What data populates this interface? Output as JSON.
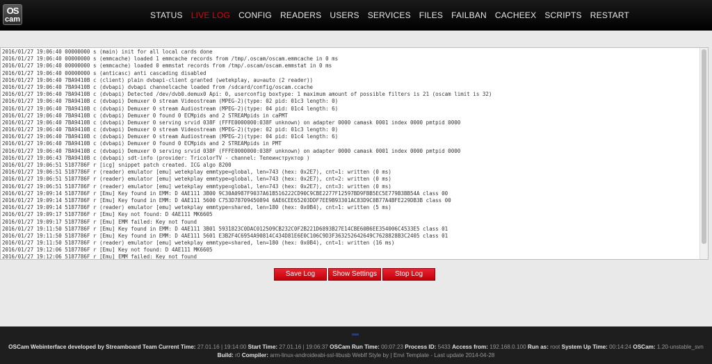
{
  "logo": {
    "line1": "OS",
    "line2": "cam"
  },
  "nav": [
    "STATUS",
    "LIVE LOG",
    "CONFIG",
    "READERS",
    "USERS",
    "SERVICES",
    "FILES",
    "FAILBAN",
    "CACHEEX",
    "SCRIPTS",
    "RESTART"
  ],
  "nav_active": "LIVE LOG",
  "log": [
    "2016/01/27 19:06:40 00000000 s (main) init for all local cards done",
    "2016/01/27 19:06:40 00000000 s (emmcache) loaded 1 emmcache records from /tmp/.oscam/oscam.emmcache in 0 ms",
    "2016/01/27 19:06:40 00000000 s (emmcache) loaded 0 emmstat records from /tmp/.oscam/oscam.emmstat in 0 ms",
    "2016/01/27 19:06:40 00000000 s (anticasc) anti cascading disabled",
    "2016/01/27 19:06:40 7BA9410B c (client) plain dvbapi-client granted (wetekplay, au=auto (2 reader))",
    "2016/01/27 19:06:40 7BA9410B c (dvbapi) dvbapi channelcache loaded from /sdcard/config/oscam.ccache",
    "2016/01/27 19:06:40 7BA9410B c (dvbapi) Detected /dev/dvb0.demux0 Api: 0, userconfig boxtype: 1 maximum amount of possible filters is 21 (oscam limit is 32)",
    "2016/01/27 19:06:40 7BA9410B c (dvbapi) Demuxer 0 stream Videostream (MPEG-2)(type: 02 pid: 01c3 length: 0)",
    "2016/01/27 19:06:40 7BA9410B c (dvbapi) Demuxer 0 stream Audiostream (MPEG-2)(type: 04 pid: 01c4 length: 6)",
    "2016/01/27 19:06:40 7BA9410B c (dvbapi) Demuxer 0 found 0 ECMpids and 2 STREAMpids in caPMT",
    "2016/01/27 19:06:40 7BA9410B c (dvbapi) Demuxer 0 serving srvid 038F (FFFE0000000:038F unknown) on adapter 0000 camask 0001 index 0000 pmtpid 0000",
    "2016/01/27 19:06:40 7BA9410B c (dvbapi) Demuxer 0 stream Videostream (MPEG-2)(type: 02 pid: 01c3 length: 0)",
    "2016/01/27 19:06:40 7BA9410B c (dvbapi) Demuxer 0 stream Audiostream (MPEG-2)(type: 04 pid: 01c4 length: 6)",
    "2016/01/27 19:06:40 7BA9410B c (dvbapi) Demuxer 0 found 0 ECMpids and 2 STREAMpids in PMT",
    "2016/01/27 19:06:40 7BA9410B c (dvbapi) Demuxer 0 serving srvid 038F (FFFE0000000:038F unknown) on adapter 0000 camask 0001 index 0000 pmtpid 0000",
    "2016/01/27 19:06:43 7BA9410B c (dvbapi) sdt-info (provider: TricolorTV - channel: Телеинструктор )",
    "2016/01/27 19:06:51 5187786F r [icg] snippet patch created. ICG algo 8200",
    "2016/01/27 19:06:51 5187786F r (reader) emulator [emu] wetekplay emmtype=global, len=743 (hex: 0x2E7), cnt=1: written (0 ms)",
    "2016/01/27 19:06:51 5187786F r (reader) emulator [emu] wetekplay emmtype=global, len=743 (hex: 0x2E7), cnt=2: written (0 ms)",
    "2016/01/27 19:06:51 5187786F r (reader) emulator [emu] wetekplay emmtype=global, len=743 (hex: 0x2E7), cnt=3: written (0 ms)",
    "2016/01/27 19:09:14 5187786F r [Emu] Key found in EMM: D 4AE111 3B00 9C30A0987F9037A61B516222CD90C9CBE2277F12597BD9FBB5EC5E779B3BB54A class 00",
    "2016/01/27 19:09:14 5187786F r [Emu] Key found in EMM: D 4AE111 5600 C753D78709450894 6AE6CEE65203DDF7EE9B93301AC83D9C8B77A4BFE229DB3B class 00",
    "2016/01/27 19:09:14 5187786F r (reader) emulator [emu] wetekplay emmtype=shared, len=180 (hex: 0x0B4), cnt=1: written (5 ms)",
    "2016/01/27 19:09:17 5187786F r [Emu] Key not found: D 4AE111 MK6605",
    "2016/01/27 19:09:17 5187786F r [Emu] EMM failed: Key not found",
    "2016/01/27 19:11:50 5187786F r [Emu] Key found in EMM: D 4AE111 3B01 5931823C0DAC012509CB232C0F2B221D6893B27E14CBE60B6EE354006C4533E5 class 01",
    "2016/01/27 19:11:50 5187786F r [Emu] Key found in EMM: D 4AE111 5601 E3B2F4C6954A90814C434D81E6E0C106C9D3F363252642649C7628828B3C2405 class 01",
    "2016/01/27 19:11:50 5187786F r (reader) emulator [emu] wetekplay emmtype=shared, len=180 (hex: 0x0B4), cnt=1: written (16 ms)",
    "2016/01/27 19:12:06 5187786F r [Emu] Key not found: D 4AE111 MK6605",
    "2016/01/27 19:12:06 5187786F r [Emu] EMM failed: Key not found"
  ],
  "buttons": {
    "save": "Save Log",
    "settings": "Show Settings",
    "stop": "Stop Log"
  },
  "footer": {
    "line1": [
      {
        "k": "OSCam Webinterface developed by Streamboard Team Current Time:",
        "v": "27.01.16 | 19:14:00"
      },
      {
        "k": "Start Time:",
        "v": "27.01.16 | 19:06:37"
      },
      {
        "k": "OSCam Run Time:",
        "v": "00:07:23"
      },
      {
        "k": "Process ID:",
        "v": "5433"
      },
      {
        "k": "Access from:",
        "v": "192.168.0.100"
      },
      {
        "k": "Run as:",
        "v": "root"
      },
      {
        "k": "System Up Time:",
        "v": "00:14:24"
      },
      {
        "k": "OSCam:",
        "v": "1.20-unstable_svn"
      }
    ],
    "line2": [
      {
        "k": "Build:",
        "v": "r0"
      },
      {
        "k": "Compiler:",
        "v": "arm-linux-androideabi-ssl-libusb WebIf Style by | Envi Template - Last update 2014-04-28"
      }
    ]
  }
}
